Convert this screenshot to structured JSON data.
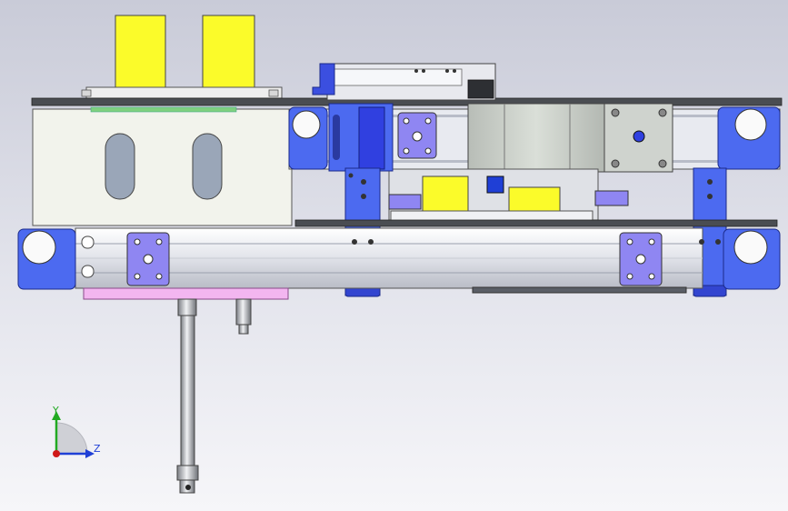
{
  "triad": {
    "y_label": "Y",
    "z_label": "Z",
    "colors": {
      "y": "#22aa22",
      "z": "#1f3fd6",
      "x": "#d01818"
    }
  },
  "colors": {
    "yellow": "#fbfb2a",
    "blue_bracket": "#4c6af0",
    "purple_plate": "#8f86f2",
    "rail": "#e4e6ec",
    "housing": "#f2f3ec",
    "motor": "#cfd3ce",
    "pink_base": "#f3b6f0",
    "dark_plate": "#4a4d52"
  },
  "part_icons": [
    "cylinder-icon",
    "linear-rail-icon",
    "stepper-motor-icon",
    "bracket-icon",
    "pulley-icon"
  ]
}
